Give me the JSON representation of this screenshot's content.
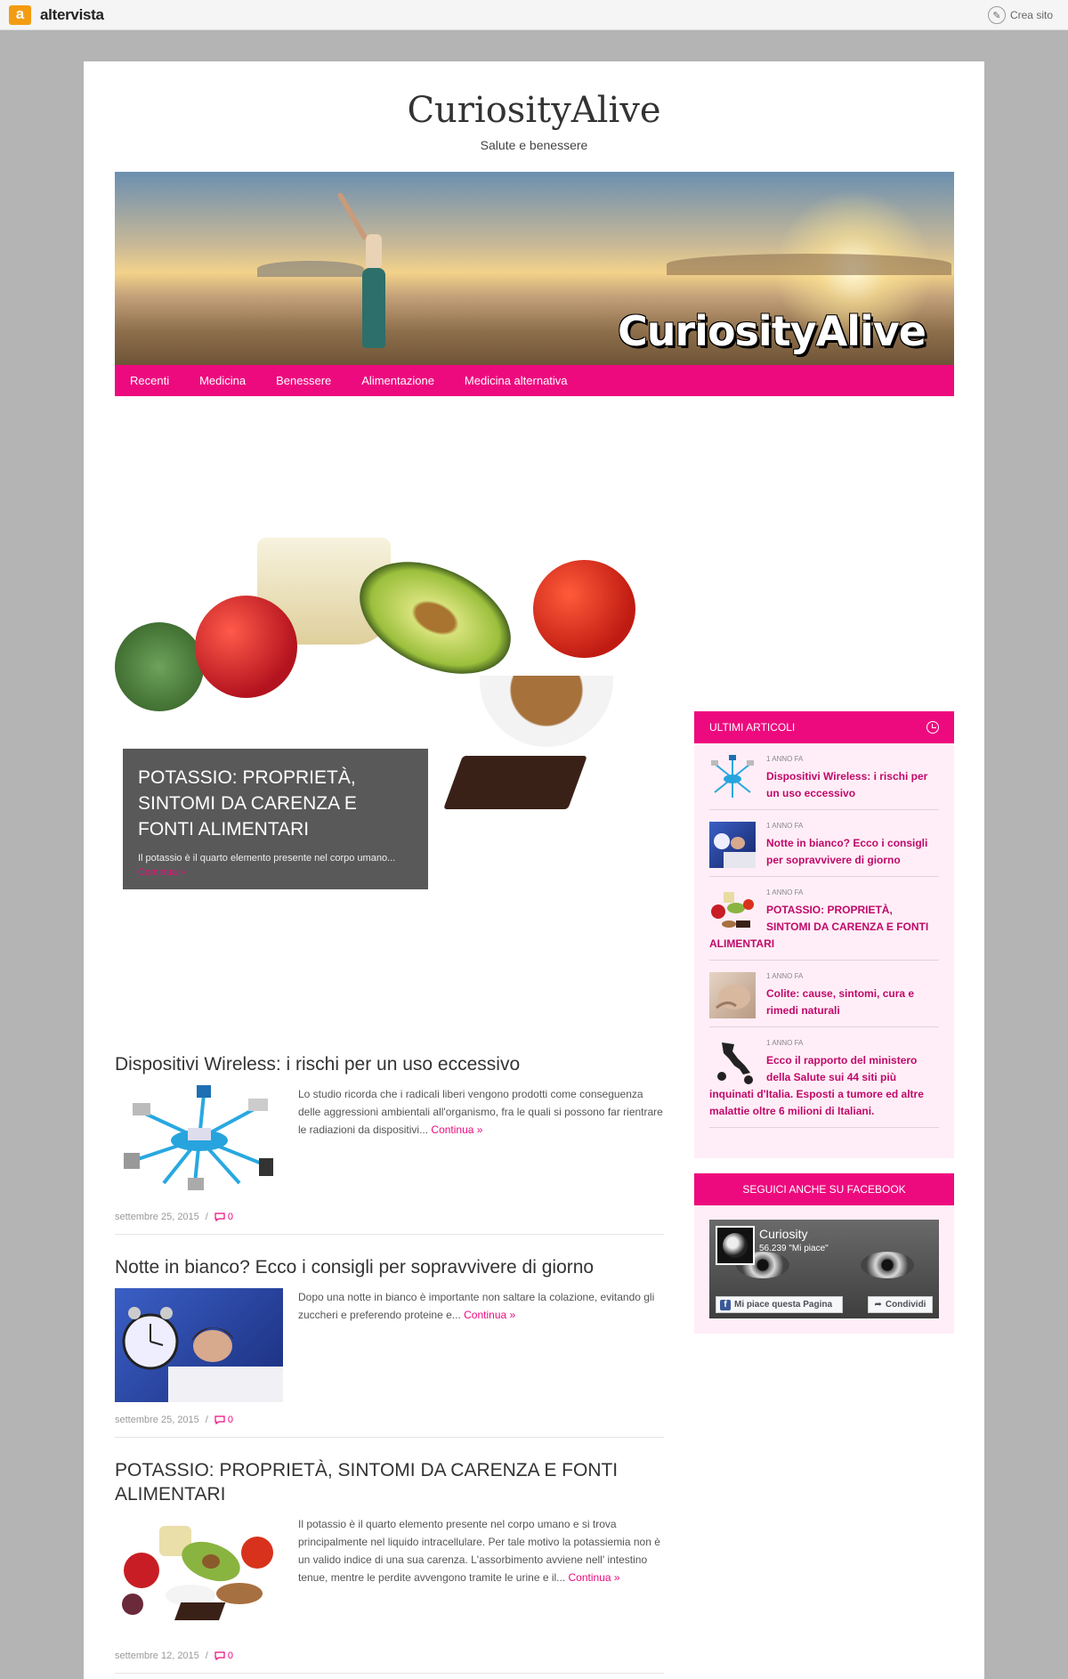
{
  "topbar": {
    "brand_letter": "a",
    "brand_name": "altervista",
    "create_site": "Crea sito"
  },
  "site": {
    "title": "CuriosityAlive",
    "tagline": "Salute e benessere",
    "banner_text": "CuriosityAlive"
  },
  "nav": {
    "items": [
      {
        "label": "Recenti"
      },
      {
        "label": "Medicina"
      },
      {
        "label": "Benessere"
      },
      {
        "label": "Alimentazione"
      },
      {
        "label": "Medicina alternativa"
      }
    ]
  },
  "featured": {
    "title": "POTASSIO: PROPRIETÀ, SINTOMI DA CARENZA E FONTI ALIMENTARI",
    "excerpt": "Il potassio è il quarto elemento presente nel corpo umano...",
    "link": "Continua »"
  },
  "posts": [
    {
      "title": "Dispositivi Wireless: i rischi per un uso eccessivo",
      "excerpt": "Lo studio ricorda che i radicali liberi vengono prodotti come conseguenza delle aggressioni ambientali all'organismo, fra le quali si possono far rientrare le radiazioni da dispositivi...",
      "link": "Continua »",
      "date": "settembre 25, 2015",
      "comments": "0",
      "sep": "/"
    },
    {
      "title": "Notte in bianco? Ecco i consigli per sopravvivere di giorno",
      "excerpt": "Dopo una notte in bianco è importante non saltare la colazione, evitando gli zuccheri e preferendo proteine e...",
      "link": "Continua »",
      "date": "settembre 25, 2015",
      "comments": "0",
      "sep": "/"
    },
    {
      "title": "POTASSIO: PROPRIETÀ, SINTOMI DA CARENZA E FONTI ALIMENTARI",
      "excerpt": "Il potassio è il quarto elemento presente nel corpo umano e si trova principalmente nel liquido intracellulare. Per tale motivo la potassiemia non è un valido indice di una sua carenza. L'assorbimento avviene nell' intestino tenue, mentre le perdite avvengono tramite le urine e il...",
      "link": "Continua »",
      "date": "settembre 12, 2015",
      "comments": "0",
      "sep": "/"
    }
  ],
  "sidebar": {
    "recent_title": "ULTIMI ARTICOLI",
    "recent": [
      {
        "time": "1 ANNO FA",
        "title": "Dispositivi Wireless: i rischi per un uso eccessivo"
      },
      {
        "time": "1 ANNO FA",
        "title": "Notte in bianco? Ecco i consigli per sopravvivere di giorno"
      },
      {
        "time": "1 ANNO FA",
        "title": "POTASSIO: PROPRIETÀ, SINTOMI DA CARENZA E FONTI ALIMENTARI"
      },
      {
        "time": "1 ANNO FA",
        "title": "Colite: cause, sintomi, cura e rimedi naturali"
      },
      {
        "time": "1 ANNO FA",
        "title": "Ecco il rapporto del ministero della Salute sui 44 siti più inquinati d'Italia. Esposti a tumore ed altre malattie oltre 6 milioni di Italiani."
      }
    ],
    "facebook_title": "SEGUICI ANCHE SU FACEBOOK",
    "fb": {
      "name": "Curiosity",
      "likes": "56.239 \"Mi piace\"",
      "like_button": "Mi piace questa Pagina",
      "share_button": "Condividi"
    }
  },
  "colors": {
    "accent": "#ed0a7e",
    "sidebar_bg": "#ffeef7",
    "page_bg": "#b4b4b4"
  }
}
